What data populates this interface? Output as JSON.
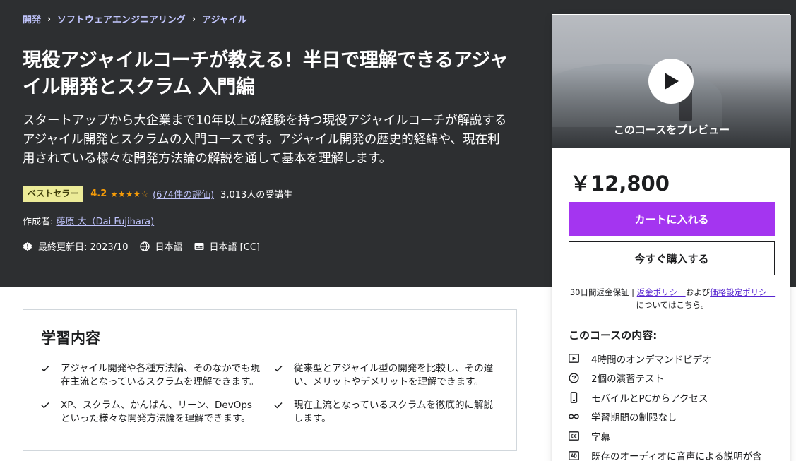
{
  "breadcrumb": {
    "items": [
      "開発",
      "ソフトウェアエンジニアリング",
      "アジャイル"
    ],
    "separator": "›"
  },
  "course": {
    "title": "現役アジャイルコーチが教える！半日で理解できるアジャイル開発とスクラム 入門編",
    "subtitle": "スタートアップから大企業まで10年以上の経験を持つ現役アジャイルコーチが解説するアジャイル開発とスクラムの入門コースです。アジャイル開発の歴史的経緯や、現在利用されている様々な開発方法論の解説を通して基本を理解します。",
    "badge": "ベストセラー",
    "rating": "4.2",
    "rating_value": 4.2,
    "stars": "★★★★☆",
    "reviews": "(674件の評価)",
    "students": "3,013人の受講生",
    "author_prefix": "作成者:",
    "author": "藤原 大（Dai Fujihara)",
    "last_updated": "最終更新日: 2023/10",
    "language": "日本語",
    "captions": "日本語 [CC]"
  },
  "sidebar": {
    "preview_label": "このコースをプレビュー",
    "price": "￥12,800",
    "add_to_cart": "カートに入れる",
    "buy_now": "今すぐ購入する",
    "guarantee_text": "30日間返金保証 | ",
    "refund_policy": "返金ポリシー",
    "and": "および",
    "pricing_policy": "価格設定ポリシー",
    "guarantee_suffix": "についてはこちら。",
    "includes_title": "このコースの内容:",
    "includes": [
      {
        "icon": "video-icon",
        "label": "4時間のオンデマンドビデオ"
      },
      {
        "icon": "quiz-icon",
        "label": "2個の演習テスト"
      },
      {
        "icon": "mobile-icon",
        "label": "モバイルとPCからアクセス"
      },
      {
        "icon": "infinity-icon",
        "label": "学習期間の制限なし"
      },
      {
        "icon": "captions-icon",
        "label": "字幕"
      },
      {
        "icon": "audio-description-icon",
        "label": "既存のオーディオに音声による説明が含"
      }
    ]
  },
  "learn": {
    "title": "学習内容",
    "items": [
      "アジャイル開発や各種方法論、そのなかでも現在主流となっているスクラムを理解できます。",
      "従来型とアジャイル型の開発を比較し、その違い、メリットやデメリットを理解できます。",
      "XP、スクラム、かんばん、リーン、DevOpsといった様々な開発方法論を理解できます。",
      "現在主流となっているスクラムを徹底的に解説します。"
    ]
  },
  "colors": {
    "hero_bg": "#2d2f31",
    "accent": "#a435f0",
    "link": "#c0c4fc",
    "star": "#f69c08",
    "badge_bg": "#eceb98"
  }
}
